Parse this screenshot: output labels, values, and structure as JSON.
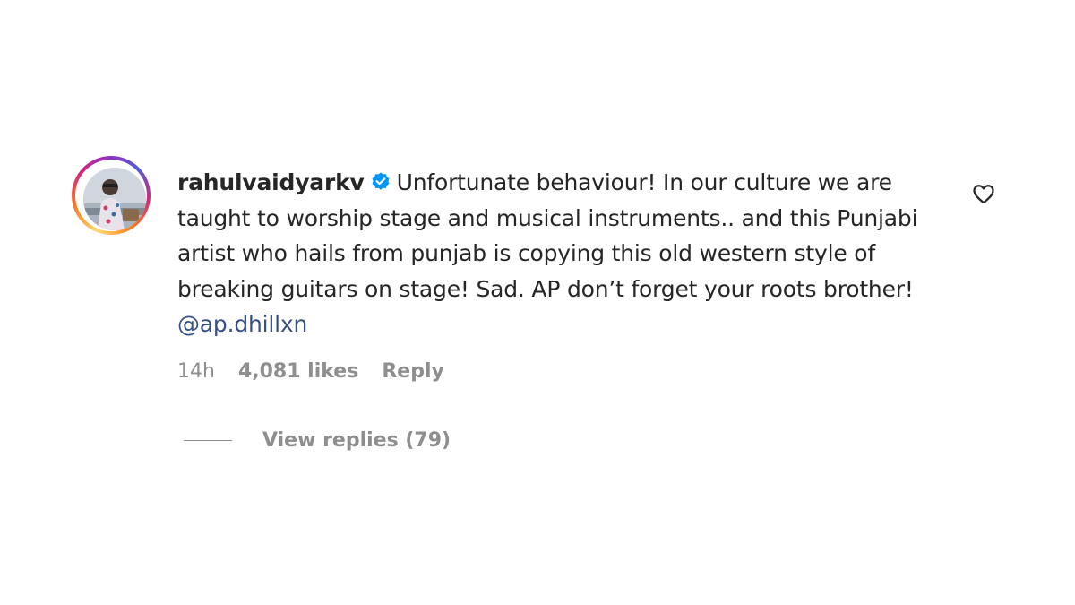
{
  "comment": {
    "username": "rahulvaidyarkv",
    "verified": true,
    "text": "Unfortunate behaviour! In our culture we are taught to worship stage and musical instruments.. and this Punjabi artist who hails from punjab is copying this old western style of breaking guitars on stage! Sad. AP don’t forget your roots brother!",
    "mention": "@ap.dhillxn",
    "time": "14h",
    "likes": "4,081 likes",
    "reply_label": "Reply",
    "view_replies_label": "View replies (79)"
  },
  "icons": {
    "verified": "verified-badge-icon",
    "like": "heart-outline-icon"
  },
  "colors": {
    "text": "#262626",
    "secondary": "#8e8e8e",
    "mention": "#385185",
    "verified": "#0095f6"
  }
}
